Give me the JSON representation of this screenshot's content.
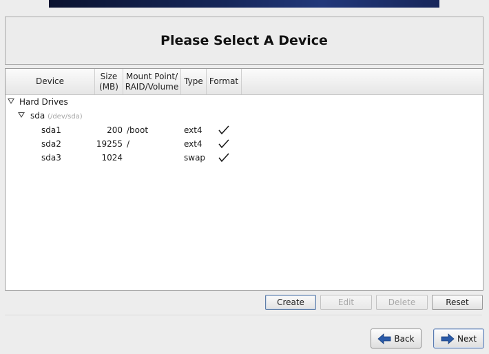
{
  "title": "Please Select A Device",
  "columns": {
    "device": "Device",
    "size_line1": "Size",
    "size_line2": "(MB)",
    "mount_line1": "Mount Point/",
    "mount_line2": "RAID/Volume",
    "type": "Type",
    "format": "Format"
  },
  "tree": {
    "group_label": "Hard Drives",
    "disk": {
      "name": "sda",
      "path": "(/dev/sda)"
    },
    "partitions": [
      {
        "device": "sda1",
        "size": "200",
        "mount": "/boot",
        "type": "ext4",
        "format": "checked"
      },
      {
        "device": "sda2",
        "size": "19255",
        "mount": "/",
        "type": "ext4",
        "format": "checked"
      },
      {
        "device": "sda3",
        "size": "1024",
        "mount": "",
        "type": "swap",
        "format": "checked"
      }
    ]
  },
  "actions": {
    "create": "Create",
    "edit": "Edit",
    "delete": "Delete",
    "reset": "Reset"
  },
  "nav": {
    "back": "Back",
    "next": "Next"
  },
  "icons": {
    "expander": "triangle-down-icon",
    "format": "checkmark-icon",
    "back": "arrow-left-icon",
    "next": "arrow-right-icon"
  },
  "colors": {
    "nav_arrow": "#2a5aa8",
    "banner": "#16275a"
  }
}
